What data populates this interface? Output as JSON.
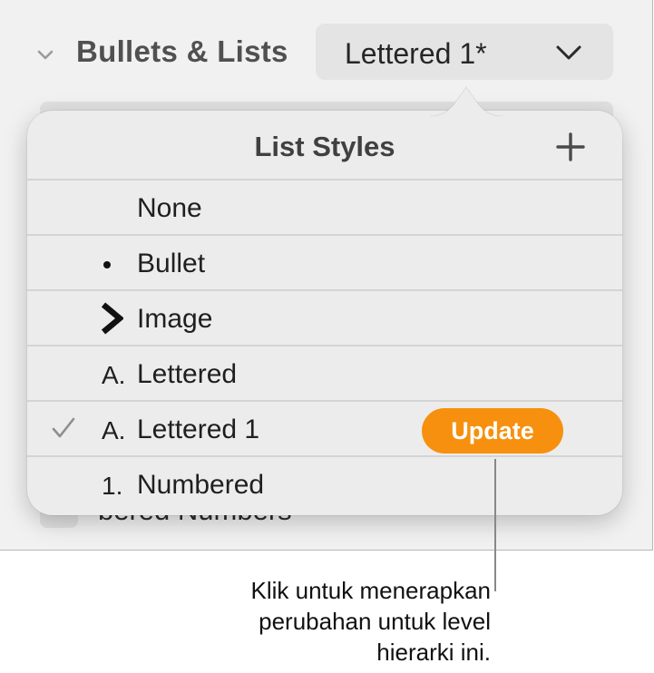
{
  "section": {
    "title": "Bullets & Lists",
    "popup_value": "Lettered 1*",
    "background_text": "bered Numbers"
  },
  "popover": {
    "title": "List Styles",
    "items": [
      {
        "label": "None",
        "marker": ""
      },
      {
        "label": "Bullet",
        "marker": "•"
      },
      {
        "label": "Image",
        "marker": "image-arrow"
      },
      {
        "label": "Lettered",
        "marker": "A."
      },
      {
        "label": "Lettered 1",
        "marker": "A.",
        "selected": true,
        "action": "Update"
      },
      {
        "label": "Numbered",
        "marker": "1."
      }
    ]
  },
  "callout": {
    "lines": [
      "Klik untuk menerapkan",
      "perubahan untuk level",
      "hierarki ini."
    ]
  },
  "colors": {
    "accent": "#f7900e",
    "panel_bg": "#f1f1f1",
    "popover_bg": "#ececec"
  }
}
